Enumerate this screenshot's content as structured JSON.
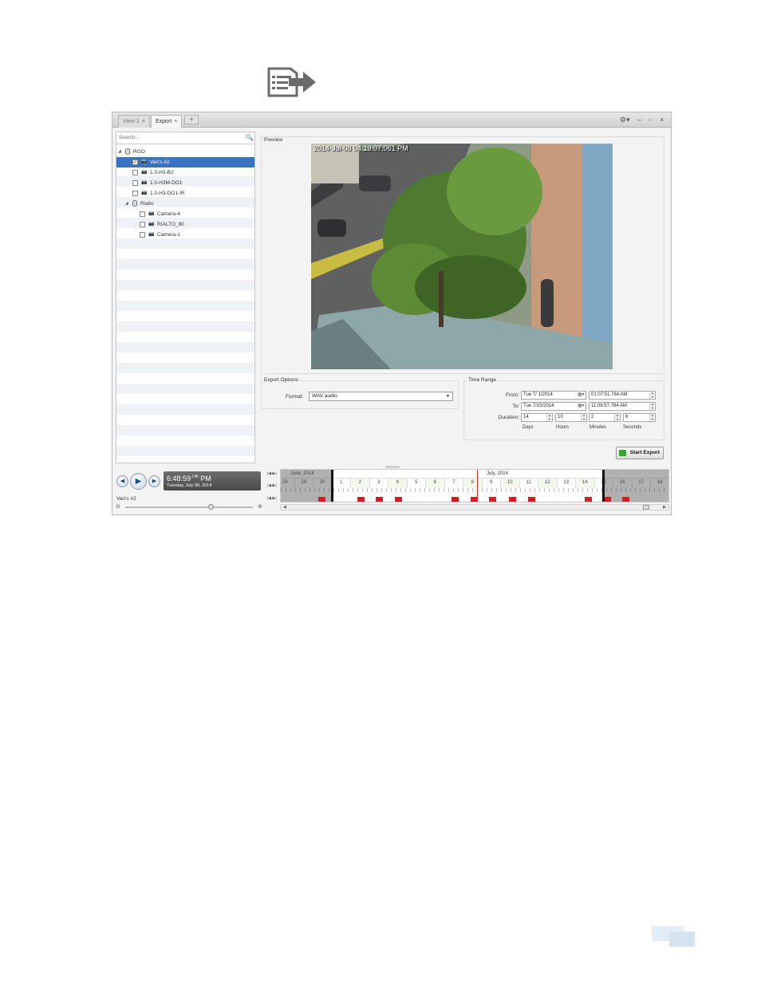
{
  "tabs": [
    {
      "label": "View 1",
      "close": "×"
    },
    {
      "label": "Export",
      "close": "×"
    }
  ],
  "add_tab": "+",
  "window_controls": {
    "settings": "⚙▾",
    "minimize": "–",
    "restore": "▫",
    "close": "×"
  },
  "search": {
    "placeholder": "Search...",
    "icon": "🔍"
  },
  "tree": [
    {
      "label": "RGO",
      "type": "site"
    },
    {
      "label": "Van's #2",
      "type": "camera",
      "checked": true,
      "selected": true
    },
    {
      "label": "1.0-H3-B2",
      "type": "camera",
      "checked": false
    },
    {
      "label": "1.0-H3M-DO1",
      "type": "camera",
      "checked": false
    },
    {
      "label": "1.0-H3-DO1-IR",
      "type": "camera",
      "checked": false
    },
    {
      "label": "Rialto",
      "type": "site"
    },
    {
      "label": "Camera-4",
      "type": "camera",
      "checked": false
    },
    {
      "label": "RIALTO_90",
      "type": "camera",
      "checked": false
    },
    {
      "label": "Camera-1",
      "type": "camera",
      "checked": false
    }
  ],
  "preview": {
    "title": "Preview",
    "osd": "2014-Jul-08 04:19:07.061 PM"
  },
  "export_options": {
    "title": "Export Options",
    "format_label": "Format:",
    "format_value": "WAV audio"
  },
  "time_range": {
    "title": "Time Range",
    "from_label": "From:",
    "from_date": "Tue   7/ 1/2014",
    "from_time": "01:07:51.784  AM",
    "to_label": "To:",
    "to_date": "Tue   7/15/2014",
    "to_time": "11:09:57.784  AM",
    "duration_label": "Duration:",
    "days": "14",
    "hours": "10",
    "minutes": "2",
    "seconds": "6",
    "units": [
      "Days",
      "Hours",
      "Minutes",
      "Seconds"
    ]
  },
  "start_export": "Start Export",
  "player": {
    "time": "6:48:59",
    "ms": ".145",
    "ampm": "PM",
    "date": "Tuesday, July 08, 2014",
    "camera": "Van's #2"
  },
  "timeline": {
    "months": [
      "June, 2014",
      "July, 2014"
    ],
    "days": [
      "28",
      "29",
      "30",
      "1",
      "2",
      "3",
      "4",
      "5",
      "6",
      "7",
      "8",
      "9",
      "10",
      "11",
      "12",
      "13",
      "14",
      "15",
      "16",
      "17",
      "18"
    ],
    "nav": [
      "|◀  ▶|",
      "|◀  ▶|",
      "|◀  ▶|"
    ],
    "scroll": [
      "◀",
      "▶"
    ],
    "zoom_out": "⊖",
    "zoom_in": "⊕"
  },
  "colors": {
    "selection": "#3a71c2",
    "record": "#cc2020",
    "export_arrow": "#3aa537"
  }
}
